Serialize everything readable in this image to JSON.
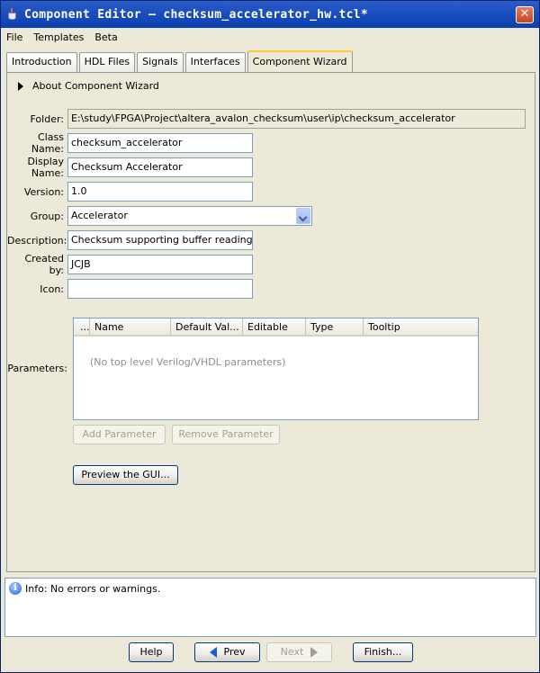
{
  "window": {
    "title": "Component Editor – checksum_accelerator_hw.tcl*"
  },
  "menu": [
    "File",
    "Templates",
    "Beta"
  ],
  "tabs": [
    {
      "label": "Introduction",
      "active": false
    },
    {
      "label": "HDL Files",
      "active": false
    },
    {
      "label": "Signals",
      "active": false
    },
    {
      "label": "Interfaces",
      "active": false
    },
    {
      "label": "Component Wizard",
      "active": true
    }
  ],
  "about": {
    "label": "About Component Wizard"
  },
  "form": {
    "folder": {
      "label": "Folder:",
      "value": "E:\\study\\FPGA\\Project\\altera_avalon_checksum\\user\\ip\\checksum_accelerator"
    },
    "class_name": {
      "label": "Class Name:",
      "value": "checksum_accelerator"
    },
    "display_name": {
      "label": "Display Name:",
      "value": "Checksum Accelerator"
    },
    "version": {
      "label": "Version:",
      "value": "1.0"
    },
    "group": {
      "label": "Group:",
      "value": "Accelerator"
    },
    "description": {
      "label": "Description:",
      "value": "Checksum supporting buffer reading"
    },
    "created_by": {
      "label": "Created by:",
      "value": "JCJB"
    },
    "icon": {
      "label": "Icon:",
      "value": ""
    }
  },
  "parameters": {
    "label": "Parameters:",
    "columns": [
      "...",
      "Name",
      "Default Val...",
      "Editable",
      "Type",
      "Tooltip"
    ],
    "empty_message": "(No top level Verilog/VHDL parameters)",
    "add_label": "Add Parameter",
    "remove_label": "Remove Parameter"
  },
  "preview_label": "Preview the GUI...",
  "status": {
    "message": "Info: No errors or warnings."
  },
  "footer": {
    "help": "Help",
    "prev": "Prev",
    "next": "Next",
    "finish": "Finish..."
  }
}
